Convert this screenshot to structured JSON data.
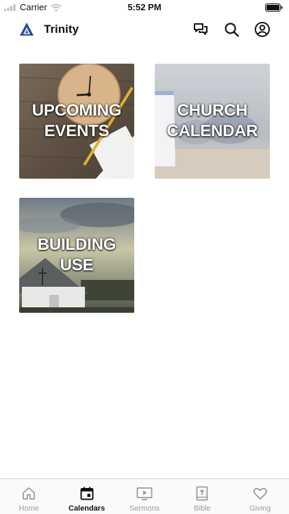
{
  "status_bar": {
    "carrier": "Carrier",
    "time": "5:52 PM"
  },
  "header": {
    "title": "Trinity",
    "icons": [
      "chat-icon",
      "search-icon",
      "account-icon"
    ]
  },
  "tiles": [
    {
      "label": "UPCOMING\nEVENTS"
    },
    {
      "label": "CHURCH\nCALENDAR"
    },
    {
      "label": "BUILDING\nUSE"
    }
  ],
  "tabbar": {
    "tabs": [
      {
        "label": "Home",
        "icon": "home-icon",
        "active": false
      },
      {
        "label": "Calendars",
        "icon": "calendar-icon",
        "active": true
      },
      {
        "label": "Sermons",
        "icon": "play-video-icon",
        "active": false
      },
      {
        "label": "Bible",
        "icon": "bible-icon",
        "active": false
      },
      {
        "label": "Giving",
        "icon": "heart-icon",
        "active": false
      }
    ]
  },
  "colors": {
    "active_tab": "#111111",
    "inactive_tab": "#9b9b9b",
    "logo_blue": "#2a4a8a"
  }
}
